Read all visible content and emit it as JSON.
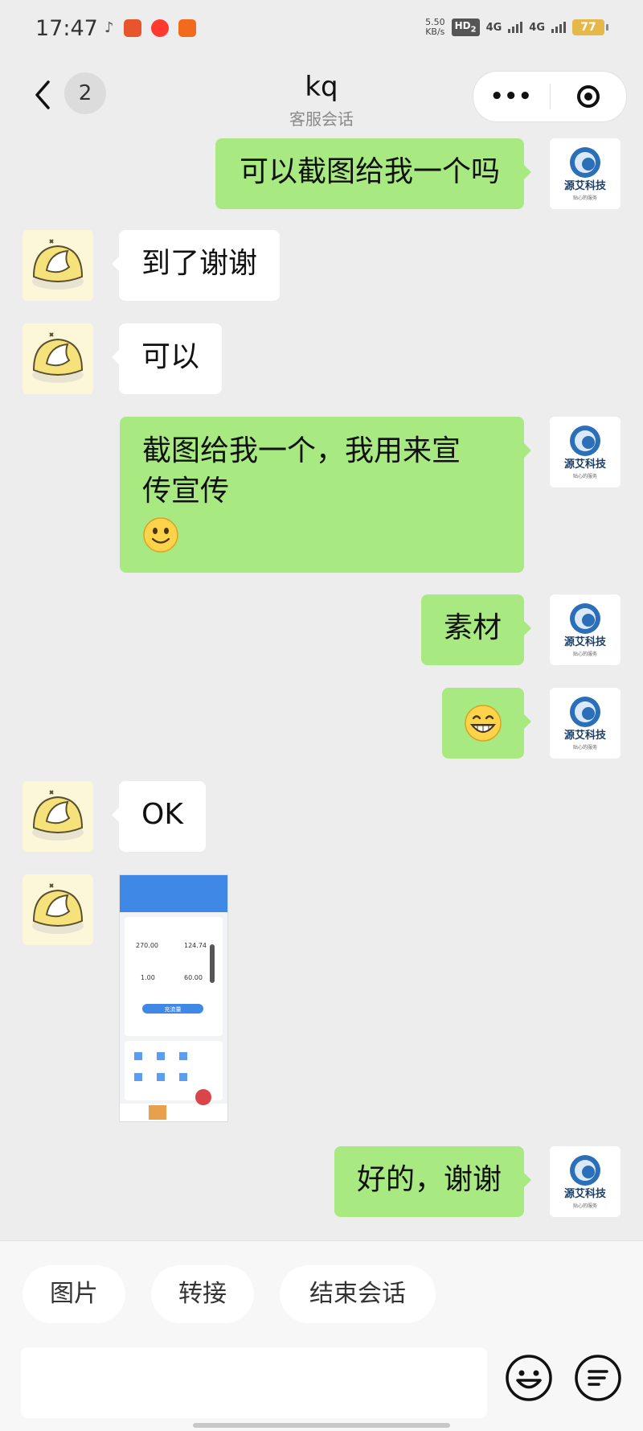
{
  "status_bar": {
    "time": "17:47",
    "speed_value": "5.50",
    "speed_unit": "KB/s",
    "hd_label": "HD",
    "hd_sub": "2",
    "net1": "4G",
    "net2": "4G",
    "battery": "77"
  },
  "header": {
    "unread_count": "2",
    "title": "kq",
    "subtitle": "客服会话"
  },
  "messages": [
    {
      "text": "可以截图给我一个吗"
    },
    {
      "text": "到了谢谢"
    },
    {
      "text": "可以"
    },
    {
      "line1": "截图给我一个，我用来宣",
      "line2": "传宣传"
    },
    {
      "text": "素材"
    },
    {
      "text": ""
    },
    {
      "text": "OK"
    },
    {
      "text": ""
    },
    {
      "text": "好的，谢谢"
    }
  ],
  "agent_logo": {
    "line1": "源艾科技",
    "line2": "贴心的服务"
  },
  "screenshot_thumb": {
    "value1": "270.00",
    "value2": "124.74",
    "value3": "1.00",
    "value4": "60.00",
    "button": "充流量"
  },
  "quick_actions": {
    "image": "图片",
    "transfer": "转接",
    "end": "结束会话"
  },
  "colors": {
    "self_bubble": "#a9e981",
    "other_bubble": "#ffffff",
    "background": "#ededed"
  }
}
